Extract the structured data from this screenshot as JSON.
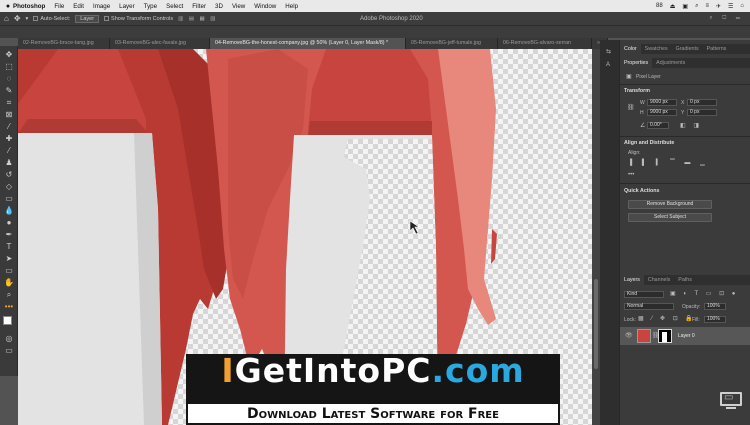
{
  "menubar": {
    "apple": "",
    "app": "Photoshop",
    "items": [
      "File",
      "Edit",
      "Image",
      "Layer",
      "Type",
      "Select",
      "Filter",
      "3D",
      "View",
      "Window",
      "Help"
    ],
    "status": [
      "88",
      "⏏",
      "▣",
      "⌕",
      "≡",
      "✈",
      "☰",
      "⌂"
    ]
  },
  "optionsbar": {
    "auto_select": "Auto-Select:",
    "layer_dropdown": "Layer",
    "show_transform": "Show Transform Controls",
    "title": "Adobe Photoshop 2020"
  },
  "tabs": [
    {
      "label": "02-RemoveBG-bruce-tang.jpg",
      "active": false
    },
    {
      "label": "03-RemoveBG-alec-favale.jpg",
      "active": false
    },
    {
      "label": "04-RemoveBG-the-honest-company.jpg @ 50% (Layer 0, Layer Mask/8) *",
      "active": true
    },
    {
      "label": "05-RemoveBG-jeff-tumale.jpg",
      "active": false
    },
    {
      "label": "06-RemoveBG-alvaro-serran",
      "active": false
    }
  ],
  "color_panel": {
    "tabs": [
      "Color",
      "Swatches",
      "Gradients",
      "Patterns"
    ]
  },
  "properties": {
    "tabs": [
      "Properties",
      "Adjustments"
    ],
    "kind": "Pixel Layer",
    "transform_title": "Transform",
    "w_label": "W",
    "w_value": "9000 px",
    "h_label": "H",
    "h_value": "9000 px",
    "x_label": "X",
    "x_value": "0 px",
    "y_label": "Y",
    "y_value": "0 px",
    "angle_value": "0.00°",
    "align_title": "Align and Distribute",
    "align_label": "Align:",
    "quick_title": "Quick Actions",
    "remove_bg": "Remove Background",
    "select_subject": "Select Subject"
  },
  "layers": {
    "tabs": [
      "Layers",
      "Channels",
      "Paths"
    ],
    "kind": "Kind",
    "blend": "Normal",
    "opacity_label": "Opacity:",
    "opacity_value": "100%",
    "lock_label": "Lock:",
    "fill_label": "Fill:",
    "fill_value": "100%",
    "layer_name": "Layer 0"
  },
  "watermark": {
    "brand_i": "I",
    "brand_get": "Get",
    "brand_into": "Into",
    "brand_pc": "PC",
    "brand_com": ".com",
    "tagline": "Download Latest Software for Free"
  },
  "colors": {
    "accent_orange": "#f0a030",
    "accent_blue": "#2aa8e0",
    "lipstick": "#c8443e"
  }
}
